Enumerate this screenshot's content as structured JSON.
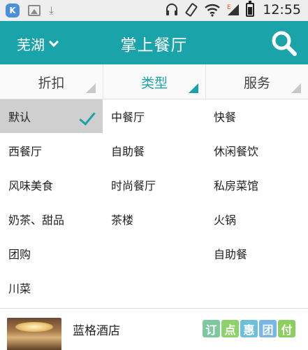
{
  "status_bar": {
    "time": "12:55",
    "left_icons": [
      "k-app-icon",
      "image-icon",
      "download-icon"
    ],
    "right_icons": [
      "headset-icon",
      "rotate-icon",
      "wifi-icon",
      "signal-icon",
      "battery-icon"
    ],
    "signal_badge": "E"
  },
  "header": {
    "city": "芜湖",
    "title": "掌上餐厅",
    "background": "#1aa3a9"
  },
  "filters": [
    {
      "label": "折扣"
    },
    {
      "label": "类型"
    },
    {
      "label": "服务"
    }
  ],
  "active_filter_color": "#1aa3a9",
  "types": {
    "col0": [
      "默认",
      "西餐厅",
      "风味美食",
      "奶茶、甜品",
      "团购",
      "川菜"
    ],
    "col1": [
      "中餐厅",
      "自助餐",
      "时尚餐厅",
      "茶楼"
    ],
    "col2": [
      "快餐",
      "休闲餐饮",
      "私房菜馆",
      "火锅",
      "自助餐"
    ],
    "selected": "默认"
  },
  "list": {
    "first_item": {
      "name": "蓝格酒店",
      "tags": [
        "订",
        "点",
        "惠",
        "团",
        "付"
      ]
    }
  }
}
